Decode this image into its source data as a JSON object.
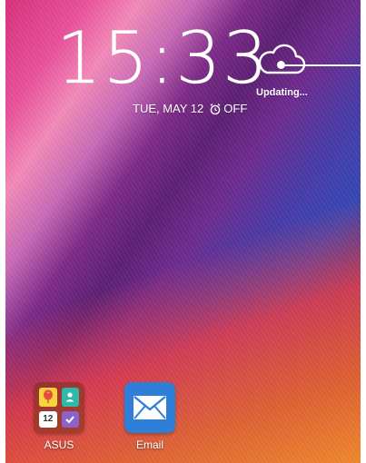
{
  "lockscreen": {
    "time": "15:33",
    "date": "TUE, MAY 12",
    "alarm_status": "OFF"
  },
  "weather": {
    "status": "Updating...",
    "icon": "cloud-icon"
  },
  "apps": [
    {
      "label": "ASUS",
      "icon": "folder-icon",
      "calendar_day": "12"
    },
    {
      "label": "Email",
      "icon": "envelope-icon"
    }
  ],
  "colors": {
    "email_blue": "#2f7fd8",
    "wallpaper_pink": "#e9509b",
    "wallpaper_purple": "#5c1f73",
    "wallpaper_orange": "#f08c28"
  }
}
